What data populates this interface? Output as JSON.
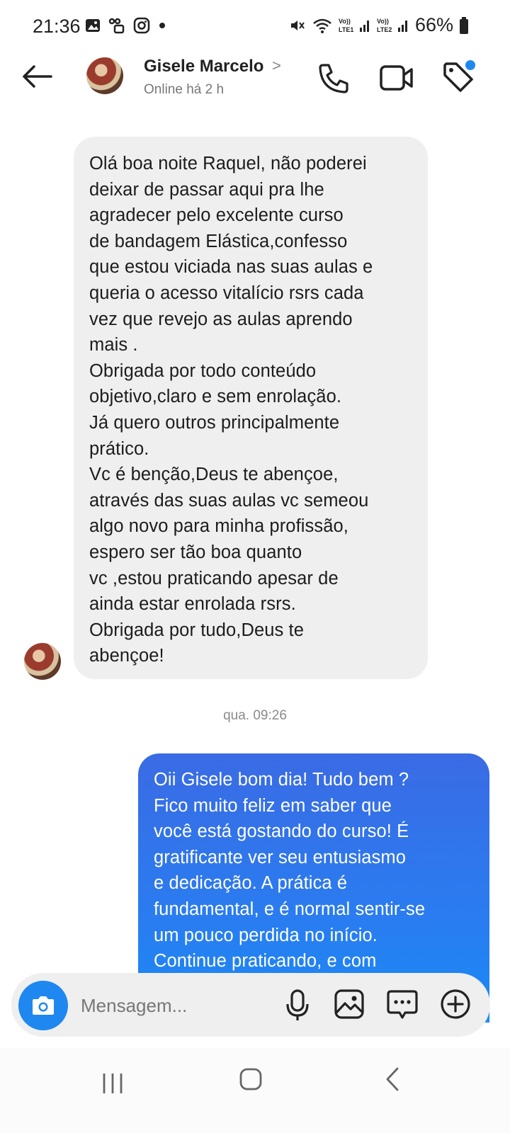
{
  "status_bar": {
    "time": "21:36",
    "battery": "66%",
    "left_icons": [
      "image-icon",
      "link-icon",
      "instagram-icon",
      "dot-icon"
    ],
    "right_icons": [
      "mute-icon",
      "wifi-icon",
      "signal-lte1-icon",
      "signal-lte2-icon",
      "battery-icon"
    ],
    "lte1_label": "Vo)) LTE1",
    "lte2_label": "Vo)) LTE2"
  },
  "header": {
    "contact_name": "Gisele Marcelo",
    "chevron": ">",
    "status": "Online há 2 h"
  },
  "messages": {
    "incoming": "Olá boa noite Raquel, não poderei\ndeixar de passar aqui pra lhe\nagradecer pelo excelente curso\nde bandagem Elástica,confesso\nque estou viciada nas suas aulas e\nqueria o acesso vitalício rsrs cada\nvez que revejo as aulas aprendo\nmais .\nObrigada por todo conteúdo\nobjetivo,claro e sem enrolação.\nJá quero outros principalmente\nprático.\nVc é benção,Deus te abençoe,\natravés das suas aulas vc semeou\nalgo novo para minha profissão,\nespero ser tão boa quanto\nvc ,estou praticando apesar de\nainda estar enrolada rsrs.\nObrigada por tudo,Deus te\nabençoe!",
    "timestamp": "qua. 09:26",
    "outgoing": "Oii Gisele bom dia! Tudo bem ?\nFico muito feliz em saber que\nvocê está gostando do curso! É\ngratificante ver seu entusiasmo\ne dedicação. A prática é\nfundamental, e é normal sentir-se\num pouco perdida no início.\nContinue praticando, e com"
  },
  "composer": {
    "placeholder": "Mensagem..."
  },
  "colors": {
    "accent": "#1e88f0",
    "outgoing_bubble": "#2a7cf0",
    "incoming_bubble": "#efefef"
  }
}
